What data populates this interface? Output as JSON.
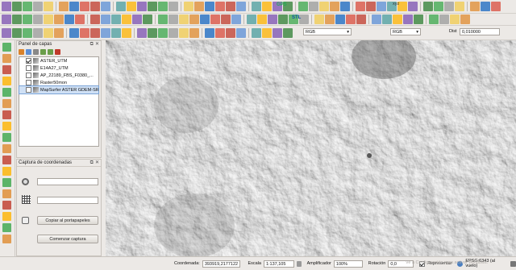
{
  "toolbar_colors": [
    "#f2c94c",
    "#5b8ed6",
    "#3aa64a",
    "#d94b3b",
    "#7b4fb0",
    "#e08a2e",
    "#4a9c9e",
    "#9a9a9a",
    "#c0392b",
    "#2e7d32",
    "#1565c0",
    "#ffb300"
  ],
  "toolbar": {
    "gps_label": "GPS",
    "stl_label": "STL",
    "rgb_select": "RGB",
    "rgb_select2": "RGB",
    "dist_label": "Dist",
    "dist_value": "0,010000",
    "xyz_label": "xyz"
  },
  "layers_panel": {
    "title": "Panel de capas",
    "layers": [
      {
        "name": "ASTER_UTM",
        "checked": true
      },
      {
        "name": "E14A27_UTM",
        "checked": false
      },
      {
        "name": "AP_22189_FBS_F0380_...",
        "checked": false
      },
      {
        "name": "Raster50mon",
        "checked": false
      },
      {
        "name": "MapSurfer ASTER GDEM-SR...",
        "checked": false,
        "selected": true
      }
    ]
  },
  "coord_panel": {
    "title": "Captura de coordenadas",
    "copy_button": "Copiar al portapapeles",
    "start_button": "Comenzar captura"
  },
  "statusbar": {
    "coord_label": "Coordenada:",
    "coord_value": "393919,2177122",
    "scale_label": "Escala",
    "scale_value": "1:137,105",
    "magnifier_label": "Amplificador",
    "magnifier_value": "100%",
    "rotation_label": "Rotación",
    "rotation_value": "0,0",
    "render_label": "Representar",
    "render_checked": true,
    "crs_label": "EPSG:6343 (al vuelo)",
    "watermark": "Ve a Configuración para activar Windows."
  }
}
